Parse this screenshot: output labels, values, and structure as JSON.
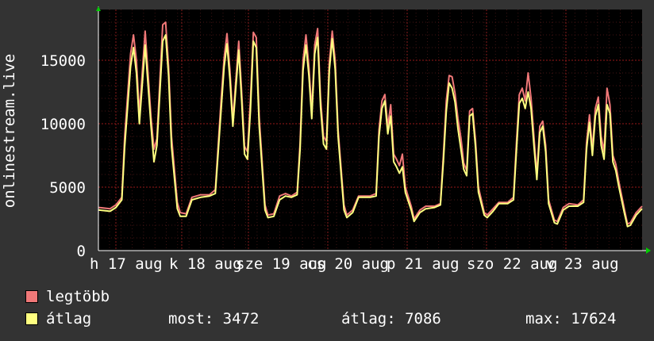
{
  "chart_data": {
    "type": "line",
    "ylabel": "onlinestream.live",
    "ylim": [
      0,
      19000
    ],
    "yticks": [
      0,
      5000,
      10000,
      15000
    ],
    "ytick_labels": [
      "0",
      "5000",
      "10000",
      "15000"
    ],
    "xtick_labels": [
      "h 17 aug",
      "k 18 aug",
      "sze 19 aug",
      "cs 20 aug",
      "p 21 aug",
      "szo 22 aug",
      "v 23 aug"
    ],
    "grid": true,
    "colors": {
      "legtöbb": "#f07878",
      "átlag": "#ffff80",
      "background": "#333333",
      "plot": "#000000",
      "grid": "#ff0000"
    },
    "series": [
      {
        "name": "legtöbb",
        "keypoints": [
          [
            0,
            3400
          ],
          [
            4,
            3300
          ],
          [
            6,
            3600
          ],
          [
            8,
            4200
          ],
          [
            9,
            9000
          ],
          [
            11,
            15500
          ],
          [
            12,
            17000
          ],
          [
            13,
            15000
          ],
          [
            14,
            10800
          ],
          [
            16,
            17300
          ],
          [
            18,
            10500
          ],
          [
            19,
            8000
          ],
          [
            20,
            8800
          ],
          [
            22,
            17800
          ],
          [
            23,
            18000
          ],
          [
            24,
            14500
          ],
          [
            25,
            9000
          ],
          [
            27,
            3800
          ],
          [
            28,
            3000
          ],
          [
            30,
            2900
          ],
          [
            32,
            4200
          ],
          [
            35,
            4400
          ],
          [
            38,
            4400
          ],
          [
            40,
            4800
          ],
          [
            42,
            12000
          ],
          [
            43,
            15200
          ],
          [
            44,
            17100
          ],
          [
            45,
            14200
          ],
          [
            46,
            10300
          ],
          [
            48,
            16500
          ],
          [
            49,
            12500
          ],
          [
            50,
            8200
          ],
          [
            51,
            7800
          ],
          [
            52,
            11800
          ],
          [
            53,
            17200
          ],
          [
            54,
            16800
          ],
          [
            55,
            10500
          ],
          [
            57,
            3600
          ],
          [
            58,
            2800
          ],
          [
            60,
            2900
          ],
          [
            62,
            4300
          ],
          [
            64,
            4500
          ],
          [
            66,
            4300
          ],
          [
            68,
            4600
          ],
          [
            69,
            8500
          ],
          [
            70,
            15000
          ],
          [
            71,
            17000
          ],
          [
            72,
            14500
          ],
          [
            73,
            11000
          ],
          [
            74,
            16200
          ],
          [
            75,
            17500
          ],
          [
            76,
            12000
          ],
          [
            77,
            9000
          ],
          [
            78,
            8600
          ],
          [
            79,
            14800
          ],
          [
            80,
            17300
          ],
          [
            81,
            15000
          ],
          [
            82,
            9500
          ],
          [
            84,
            3600
          ],
          [
            85,
            2800
          ],
          [
            87,
            3200
          ],
          [
            89,
            4300
          ],
          [
            93,
            4300
          ],
          [
            95,
            4500
          ],
          [
            96,
            9500
          ],
          [
            97,
            11800
          ],
          [
            98,
            12300
          ],
          [
            99,
            9800
          ],
          [
            100,
            11500
          ],
          [
            101,
            7600
          ],
          [
            102,
            7200
          ],
          [
            103,
            6700
          ],
          [
            104,
            7600
          ],
          [
            105,
            5000
          ],
          [
            107,
            3500
          ],
          [
            108,
            2500
          ],
          [
            110,
            3200
          ],
          [
            112,
            3500
          ],
          [
            115,
            3500
          ],
          [
            117,
            3700
          ],
          [
            118,
            7500
          ],
          [
            119,
            11800
          ],
          [
            120,
            13800
          ],
          [
            121,
            13700
          ],
          [
            122,
            12400
          ],
          [
            123,
            10400
          ],
          [
            124,
            8900
          ],
          [
            125,
            6900
          ],
          [
            126,
            6300
          ],
          [
            127,
            11000
          ],
          [
            128,
            11200
          ],
          [
            129,
            8700
          ],
          [
            130,
            5000
          ],
          [
            132,
            3000
          ],
          [
            133,
            2800
          ],
          [
            135,
            3300
          ],
          [
            137,
            3800
          ],
          [
            140,
            3800
          ],
          [
            142,
            4200
          ],
          [
            143,
            8400
          ],
          [
            144,
            12300
          ],
          [
            145,
            12800
          ],
          [
            146,
            11800
          ],
          [
            147,
            14000
          ],
          [
            148,
            12000
          ],
          [
            149,
            9000
          ],
          [
            150,
            6000
          ],
          [
            151,
            9800
          ],
          [
            152,
            10200
          ],
          [
            153,
            8300
          ],
          [
            154,
            4000
          ],
          [
            156,
            2400
          ],
          [
            157,
            2300
          ],
          [
            159,
            3400
          ],
          [
            161,
            3700
          ],
          [
            164,
            3600
          ],
          [
            166,
            4000
          ],
          [
            167,
            8500
          ],
          [
            168,
            10700
          ],
          [
            169,
            8000
          ],
          [
            170,
            11200
          ],
          [
            171,
            12100
          ],
          [
            172,
            9000
          ],
          [
            173,
            7800
          ],
          [
            174,
            12800
          ],
          [
            175,
            11500
          ],
          [
            176,
            7500
          ],
          [
            177,
            6800
          ],
          [
            178,
            5500
          ],
          [
            180,
            3200
          ],
          [
            181,
            2100
          ],
          [
            182,
            2200
          ],
          [
            184,
            3000
          ],
          [
            186,
            3500
          ]
        ]
      },
      {
        "name": "átlag",
        "keypoints": [
          [
            0,
            3200
          ],
          [
            4,
            3100
          ],
          [
            6,
            3400
          ],
          [
            8,
            4000
          ],
          [
            9,
            8200
          ],
          [
            11,
            14500
          ],
          [
            12,
            16000
          ],
          [
            13,
            14000
          ],
          [
            14,
            10000
          ],
          [
            16,
            16200
          ],
          [
            18,
            9800
          ],
          [
            19,
            7000
          ],
          [
            20,
            8300
          ],
          [
            22,
            16500
          ],
          [
            23,
            17000
          ],
          [
            24,
            13800
          ],
          [
            25,
            8200
          ],
          [
            27,
            3300
          ],
          [
            28,
            2700
          ],
          [
            30,
            2700
          ],
          [
            32,
            4000
          ],
          [
            35,
            4200
          ],
          [
            38,
            4300
          ],
          [
            40,
            4500
          ],
          [
            42,
            11200
          ],
          [
            43,
            14500
          ],
          [
            44,
            16300
          ],
          [
            45,
            13500
          ],
          [
            46,
            9800
          ],
          [
            48,
            15800
          ],
          [
            49,
            11800
          ],
          [
            50,
            7600
          ],
          [
            51,
            7200
          ],
          [
            52,
            11000
          ],
          [
            53,
            16500
          ],
          [
            54,
            16000
          ],
          [
            55,
            9800
          ],
          [
            57,
            3200
          ],
          [
            58,
            2600
          ],
          [
            60,
            2700
          ],
          [
            62,
            4000
          ],
          [
            64,
            4300
          ],
          [
            66,
            4200
          ],
          [
            68,
            4400
          ],
          [
            69,
            8000
          ],
          [
            70,
            14200
          ],
          [
            71,
            16200
          ],
          [
            72,
            13800
          ],
          [
            73,
            10400
          ],
          [
            74,
            15500
          ],
          [
            75,
            16800
          ],
          [
            76,
            11300
          ],
          [
            77,
            8400
          ],
          [
            78,
            8000
          ],
          [
            79,
            14200
          ],
          [
            80,
            16700
          ],
          [
            81,
            14300
          ],
          [
            82,
            9000
          ],
          [
            84,
            3200
          ],
          [
            85,
            2600
          ],
          [
            87,
            3000
          ],
          [
            89,
            4200
          ],
          [
            93,
            4200
          ],
          [
            95,
            4300
          ],
          [
            96,
            9000
          ],
          [
            97,
            11200
          ],
          [
            98,
            11800
          ],
          [
            99,
            9200
          ],
          [
            100,
            10600
          ],
          [
            101,
            7000
          ],
          [
            102,
            6600
          ],
          [
            103,
            6100
          ],
          [
            104,
            6600
          ],
          [
            105,
            4600
          ],
          [
            107,
            3200
          ],
          [
            108,
            2300
          ],
          [
            110,
            3000
          ],
          [
            112,
            3300
          ],
          [
            115,
            3400
          ],
          [
            117,
            3600
          ],
          [
            118,
            7000
          ],
          [
            119,
            11000
          ],
          [
            120,
            13200
          ],
          [
            121,
            12800
          ],
          [
            122,
            11700
          ],
          [
            123,
            9600
          ],
          [
            124,
            8000
          ],
          [
            125,
            6400
          ],
          [
            126,
            5900
          ],
          [
            127,
            10600
          ],
          [
            128,
            10800
          ],
          [
            129,
            8200
          ],
          [
            130,
            4600
          ],
          [
            132,
            2800
          ],
          [
            133,
            2600
          ],
          [
            135,
            3100
          ],
          [
            137,
            3700
          ],
          [
            140,
            3700
          ],
          [
            142,
            4000
          ],
          [
            143,
            7800
          ],
          [
            144,
            11600
          ],
          [
            145,
            12000
          ],
          [
            146,
            11200
          ],
          [
            147,
            12500
          ],
          [
            148,
            11200
          ],
          [
            149,
            8300
          ],
          [
            150,
            5600
          ],
          [
            151,
            9300
          ],
          [
            152,
            9800
          ],
          [
            153,
            7800
          ],
          [
            154,
            3700
          ],
          [
            156,
            2200
          ],
          [
            157,
            2100
          ],
          [
            159,
            3200
          ],
          [
            161,
            3500
          ],
          [
            164,
            3500
          ],
          [
            166,
            3800
          ],
          [
            167,
            8000
          ],
          [
            168,
            10100
          ],
          [
            169,
            7500
          ],
          [
            170,
            10600
          ],
          [
            171,
            11500
          ],
          [
            172,
            8300
          ],
          [
            173,
            7200
          ],
          [
            174,
            11500
          ],
          [
            175,
            10800
          ],
          [
            176,
            7000
          ],
          [
            177,
            6300
          ],
          [
            178,
            5100
          ],
          [
            180,
            2900
          ],
          [
            181,
            1900
          ],
          [
            182,
            2000
          ],
          [
            184,
            2800
          ],
          [
            186,
            3300
          ]
        ]
      }
    ]
  },
  "legend": {
    "items": [
      {
        "label": "legtöbb",
        "color": "#f07878"
      },
      {
        "label": "átlag",
        "color": "#ffff80"
      }
    ]
  },
  "stats": {
    "now_label": "most: 3472",
    "avg_label": "átlag: 7086",
    "max_label": "max: 17624"
  }
}
